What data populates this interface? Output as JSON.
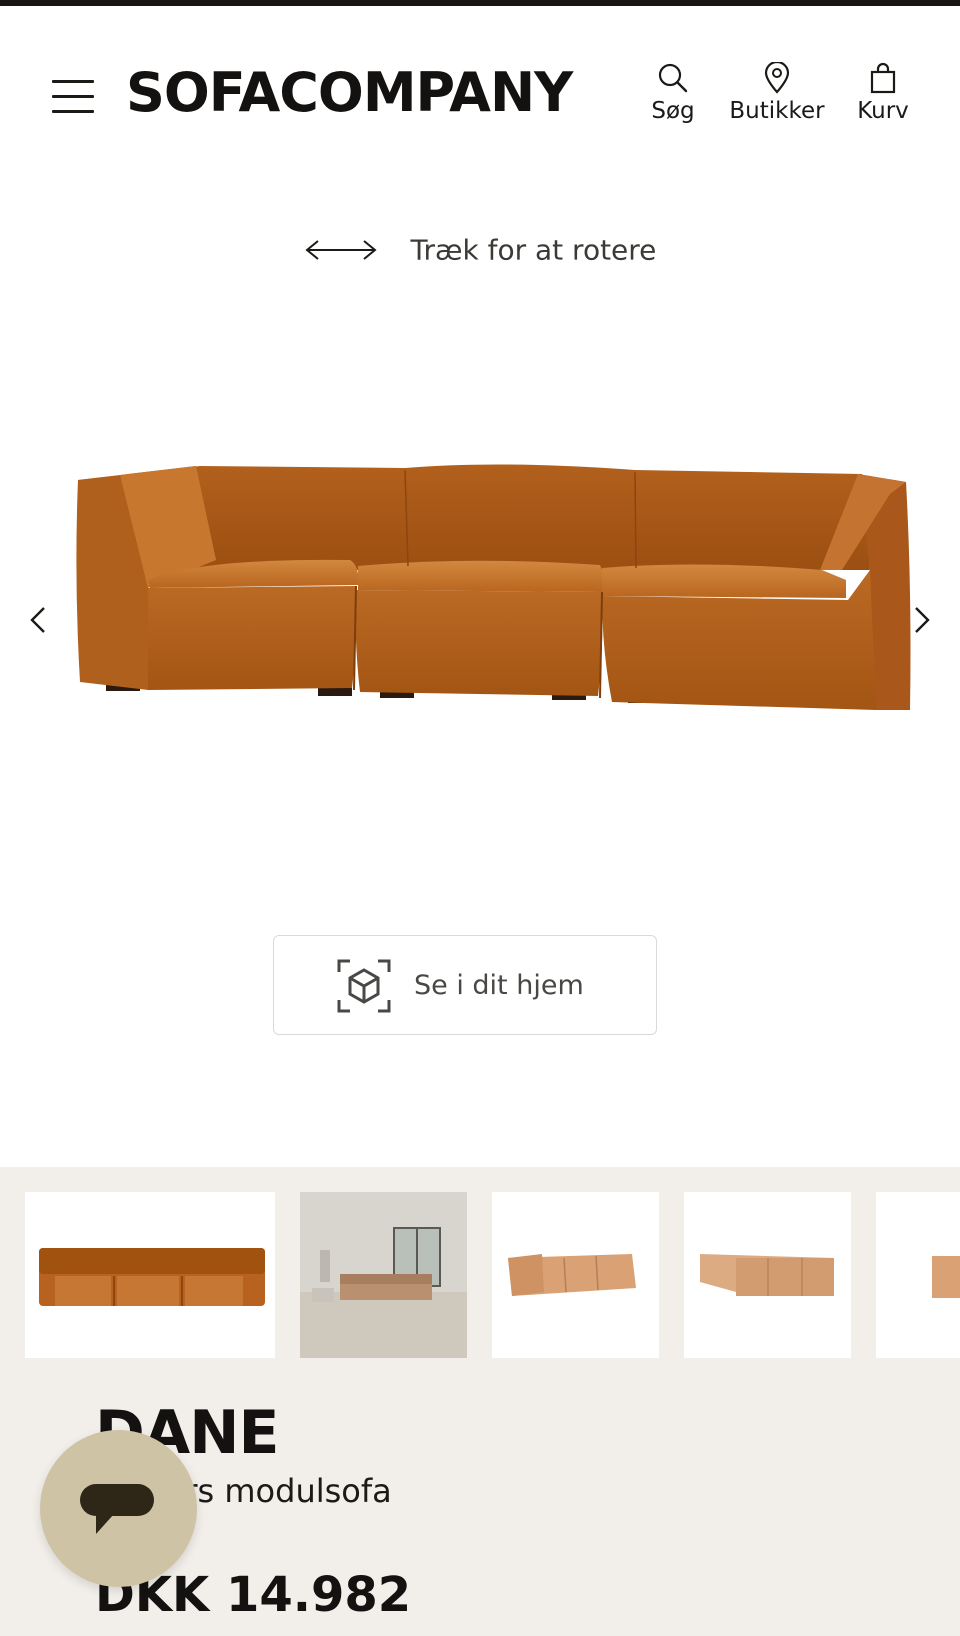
{
  "header": {
    "brand": "SOFACOMPANY",
    "nav": [
      {
        "label": "Søg",
        "icon": "search-icon"
      },
      {
        "label": "Butikker",
        "icon": "location-pin-icon"
      },
      {
        "label": "Kurv",
        "icon": "shopping-bag-icon"
      }
    ]
  },
  "viewer": {
    "rotate_hint": "Træk for at rotere",
    "ar_button_label": "Se i dit hjem"
  },
  "gallery": {
    "thumbnails": [
      {
        "alt": "sofa-front-view"
      },
      {
        "alt": "sofa-room-scene"
      },
      {
        "alt": "sofa-angle-view"
      },
      {
        "alt": "sofa-back-view"
      },
      {
        "alt": "sofa-partial-view"
      }
    ]
  },
  "product": {
    "name": "DANE",
    "subtitle": "rsoners modulsofa",
    "price": "DKK 14.982"
  },
  "colors": {
    "sofa": "#b8621d",
    "sofa_light": "#d9a174",
    "panel_bg": "#f2eeea",
    "chat_bg": "#cfc3a6"
  }
}
